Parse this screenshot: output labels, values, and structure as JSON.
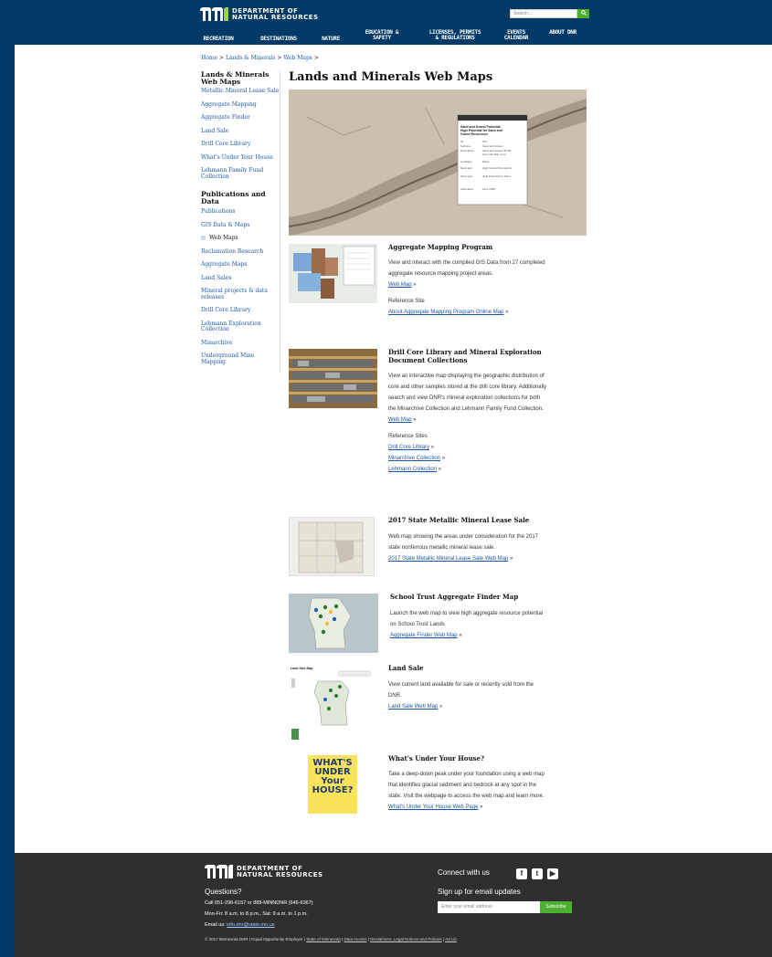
{
  "header": {
    "logo_line1": "DEPARTMENT OF",
    "logo_line2": "NATURAL RESOURCES",
    "search_placeholder": "Search...",
    "search_icon": "magnifier-icon",
    "nav": [
      "RECREATION",
      "DESTINATIONS",
      "NATURE",
      "EDUCATION & SAFETY",
      "LICENSES, PERMITS & REGULATIONS",
      "EVENTS CALENDAR",
      "ABOUT DNR"
    ]
  },
  "breadcrumb": {
    "home": "Home",
    "sep": ">",
    "lands": "Lands & Minerals",
    "webmaps": "Web Maps"
  },
  "leftnav": {
    "heading1": "Lands & Minerals Web Maps",
    "items1": [
      "Metallic Mineral Lease Sale",
      "Aggregate Mapping",
      "Aggregate Finder",
      "Land Sale",
      "Drill Core Library",
      "What's Under Your House",
      "Lehmann Family Fund Collection"
    ],
    "heading2": "Publications and Data",
    "items2": [
      "Publications",
      "GIS Data & Maps",
      "Web Maps",
      "Reclamation Research",
      "Aggregate Maps",
      "Land Sales",
      "Mineral projects & data releases",
      "Drill Core Library",
      "Lehmann Exploration Collection",
      "Minarchive",
      "Underground Mine Mapping"
    ]
  },
  "main": {
    "title": "Lands and Minerals Web Maps",
    "hero_popup_title": "Sand and Gravel Potential: High Potential for Sand and Gravel Resources",
    "sections": [
      {
        "title": "Aggregate Mapping Program",
        "body": "View and interact with the compiled GIS Data from 27 completed aggregate resource mapping project areas.",
        "link": "Web Map",
        "ref_label": "Reference Site",
        "ref_links": [
          "About Aggregate Mapping Program Online Map"
        ]
      },
      {
        "title": "Drill Core Library and Mineral Exploration Document Collections",
        "body": "View an interactive map displaying the geographic distribution of core and other samples stored at the drill core library. Additionally search and view DNR's mineral exploration collections for both the Minarchive Collection and Lehmann Family Fund Collection.",
        "link": "Web Map",
        "ref_label": "Reference Sites",
        "ref_links": [
          "Drill Core Library",
          "Minarchive Collection",
          "Lehmann Collection"
        ]
      },
      {
        "title": "2017 State Metallic Mineral Lease Sale",
        "body": "Web map showing the areas under consideration for the 2017 state nonferrous metallic mineral lease sale.",
        "link": "2017 State Metallic Mineral Lease Sale Web Map"
      },
      {
        "title": "School Trust Aggregate Finder Map",
        "body": "Launch the web map to view high aggregate resource potential on School Trust Lands",
        "link": "Aggregate Finder Web Map"
      },
      {
        "title": "Land Sale",
        "body": "View current land available for sale or recently sold from the DNR.",
        "link": "Land Sale Web Map",
        "thumb_caption": "Land Sale Map"
      },
      {
        "title": "What's Under Your House?",
        "body": "Take a deep-down peak under your foundation using a web map that identifies glacial sediment and bedrock at any spot in the state. Visit the webpage to access the web map and learn more.",
        "link": "What's Under Your House Web Page",
        "thumb_text": "WHAT'S UNDER Your HOUSE?"
      }
    ]
  },
  "footer": {
    "questions": "Questions?",
    "phone": "Call 651-296-6157 or 888-MINNDNR (646-6367)",
    "hours": "Mon-Fri: 8 a.m. to 8 p.m., Sat: 9 a.m. to 1 p.m.",
    "email_label": "Email us:",
    "email": "info.dnr@state.mn.us",
    "connect": "Connect with us",
    "signup": "Sign up for email updates",
    "email_placeholder": "Enter your email address",
    "subscribe": "Subscribe",
    "copyright": "© 2017 Minnesota DNR | Equal Opportunity Employer |",
    "links": [
      "State of Minnesota",
      "Data Access",
      "Disclaimers, Legal Notices and Policies",
      "Ad Lib"
    ]
  },
  "colors": {
    "header": "#013a66",
    "accent": "#4caf2f",
    "footer": "#2f2f2f",
    "link": "#1b57a6"
  }
}
